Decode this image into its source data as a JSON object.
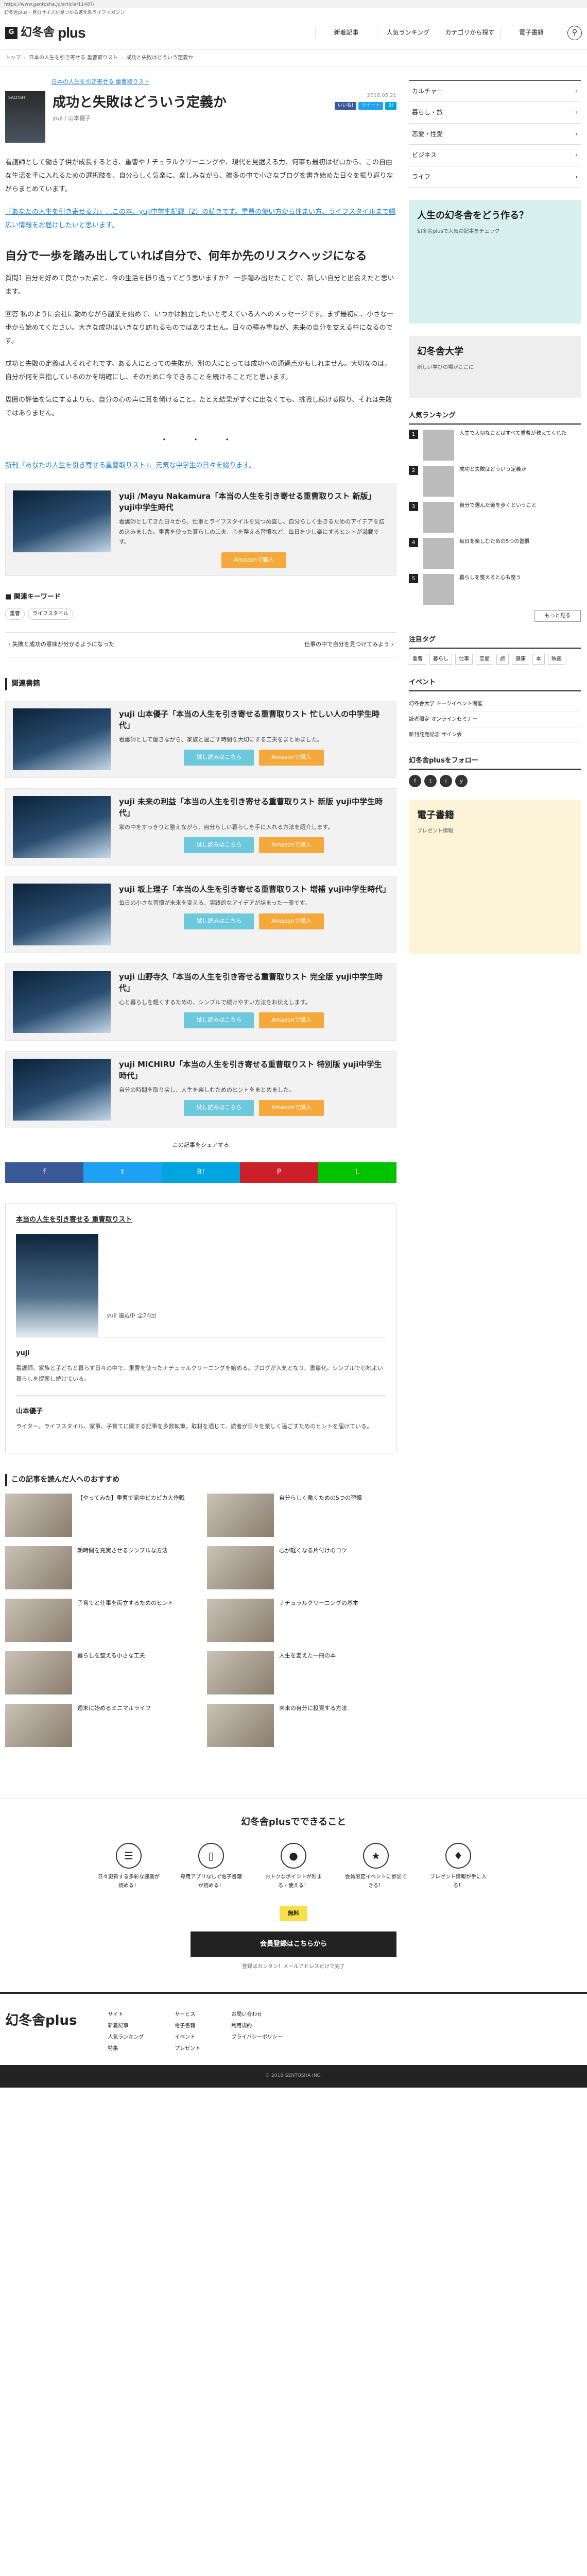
{
  "url": "https://www.gentosha.jp/article/11487/",
  "tagline": "幻冬舎plus - 自分サイズが見つかる進化系ライフマガジン",
  "brand": {
    "logo_mark": "G",
    "name_jp": "幻冬舎",
    "name_en": "plus"
  },
  "nav": {
    "items": [
      "新着記事",
      "人気ランキング",
      "カテゴリから探す",
      "電子書籍"
    ]
  },
  "breadcrumb": [
    "トップ",
    "日本の人生を引き寄せる 重曹取りスト",
    "成功と失敗はどういう定義か"
  ],
  "article": {
    "series": "日本の人生を引き寄せる 重曹取りスト",
    "thumb_text": "SALTISH",
    "title": "成功と失敗はどういう定義か",
    "author": "yuji / 山本優子",
    "date": "2018.05.21",
    "share_buttons": [
      "いいね!",
      "ツイート",
      "B!"
    ],
    "paragraphs": [
      "看護師として働き子供が成長するとき、重曹やナチュラルクリーニングや、現代を見据える力、何事も最初はゼロから、この自由な生活を手に入れるための選択肢を、自分らしく気楽に、楽しみながら、雑多の中で小さなブログを書き始めた日々を振り返りながらまとめています。",
      "『あなたの人生を引き寄せる力』…この本、yuji中学生記録（2）の続きです。重曹の使い方から住まい方、ライフスタイルまで幅広い情報をお届けしたいと思います。"
    ],
    "h2_1": "自分で一歩を踏み出していれば自分で、何年か先のリスクヘッジになる",
    "body_1": [
      "質問1 自分を好めて良かった点と、今の生活を振り返ってどう思いますか？ 一歩踏み出せたことで、新しい自分と出会えたと思います。",
      "回答 私のように会社に勤めながら副業を始めて、いつかは独立したいと考えている人へのメッセージです。まず最初に、小さな一歩から始めてください。大きな成功はいきなり訪れるものではありません。日々の積み重ねが、未来の自分を支える柱になるのです。",
      "成功と失敗の定義は人それぞれです。ある人にとっての失敗が、別の人にとっては成功への通過点かもしれません。大切なのは、自分が何を目指しているのかを明確にし、そのために今できることを続けることだと思います。",
      "周囲の評価を気にするよりも、自分の心の声に耳を傾けること。たとえ結果がすぐに出なくても、挑戦し続ける限り、それは失敗ではありません。"
    ],
    "dots": "・ ・ ・",
    "footnote": "新刊『あなたの人生を引き寄せる重曹取りスト』、元気な中学生の日々を綴ります。",
    "promo": {
      "title": "yuji /Mayu Nakamura「本当の人生を引き寄せる重曹取りスト 新版」yuji中学生時代",
      "desc": "看護師としてきた日々から、仕事とライフスタイルを見つめ直し、自分らしく生きるためのアイデアを詰め込みました。重曹を使った暮らしの工夫、心を整える習慣など、毎日を少し楽にするヒントが満載です。",
      "btn_buy": "Amazonで購入",
      "btn_preview": "試し読みはこちら"
    }
  },
  "keyword": {
    "label": "関連キーワード",
    "tags": [
      "重曹",
      "ライフスタイル"
    ]
  },
  "prevnext": {
    "prev": "失敗と成功の意味が分かるようになった",
    "next": "仕事の中で自分を見つけてみよう"
  },
  "related": {
    "title": "関連書籍",
    "items": [
      {
        "title": "yuji 山本優子「本当の人生を引き寄せる重曹取りスト 忙しい人の中学生時代」",
        "desc": "看護師として働きながら、家族と過ごす時間を大切にする工夫をまとめました。"
      },
      {
        "title": "yuji 未来の利益「本当の人生を引き寄せる重曹取りスト 新版 yuji中学生時代」",
        "desc": "家の中をすっきりと整えながら、自分らしい暮らしを手に入れる方法を紹介します。"
      },
      {
        "title": "yuji 坂上理子「本当の人生を引き寄せる重曹取りスト 増補 yuji中学生時代」",
        "desc": "毎日の小さな習慣が未来を変える、実践的なアイデアが詰まった一冊です。"
      },
      {
        "title": "yuji 山野寺久「本当の人生を引き寄せる重曹取りスト 完全版 yuji中学生時代」",
        "desc": "心と暮らしを軽くするための、シンプルで続けやすい方法をお伝えします。"
      },
      {
        "title": "yuji MICHIRU「本当の人生を引き寄せる重曹取りスト 特別版 yuji中学生時代」",
        "desc": "自分の時間を取り戻し、人生を楽しむためのヒントをまとめました。"
      }
    ]
  },
  "share": {
    "label": "この記事をシェアする",
    "buttons": [
      "f",
      "t",
      "B!",
      "P",
      "L"
    ]
  },
  "magazine": {
    "title": "本当の人生を引き寄せる 重曹取りスト",
    "info": "yuji 連載中 全24回",
    "profile_name": "yuji",
    "profile_text": "看護師。家族と子どもと暮らす日々の中で、重曹を使ったナチュラルクリーニングを始める。ブログが人気となり、書籍化。シンプルで心地よい暮らしを提案し続けている。",
    "author2_name": "山本優子",
    "author2_text": "ライター。ライフスタイル、家事、子育てに関する記事を多数執筆。取材を通じて、読者が日々を楽しく過ごすためのヒントを届けている。"
  },
  "recommend": {
    "title": "この記事を読んだ人へのおすすめ",
    "items": [
      "【やってみた】重曹で家中ピカピカ大作戦",
      "自分らしく働くための5つの習慣",
      "朝時間を充実させるシンプルな方法",
      "心が軽くなる片付けのコツ",
      "子育てと仕事を両立するためのヒント",
      "ナチュラルクリーニングの基本",
      "暮らしを整える小さな工夫",
      "人生を変えた一冊の本",
      "週末に始めるミニマルライフ",
      "未来の自分に投資する方法"
    ]
  },
  "sidebar": {
    "nav": [
      "カルチャー",
      "暮らし・旅",
      "恋愛・性愛",
      "ビジネス",
      "ライフ"
    ],
    "ad": {
      "title": "人生の幻冬舎をどう作る？",
      "sub": "幻冬舎plusで人気の記事をチェック"
    },
    "ad2": {
      "title": "幻冬舎大学",
      "sub": "新しい学びの場がここに"
    },
    "ranking_title": "人気ランキング",
    "ranking": [
      "人生で大切なことはすべて重曹が教えてくれた",
      "成功と失敗はどういう定義か",
      "自分で選んだ道を歩くということ",
      "毎日を楽しむための5つの習慣",
      "暮らしを整えると心も整う"
    ],
    "more": "もっと見る",
    "tag_title": "注目タグ",
    "tags": [
      "重曹",
      "暮らし",
      "仕事",
      "恋愛",
      "旅",
      "健康",
      "本",
      "映画"
    ],
    "event_title": "イベント",
    "events": [
      "幻冬舎大学 トークイベント開催",
      "読者限定 オンラインセミナー",
      "新刊発売記念 サイン会"
    ],
    "follow_title": "幻冬舎plusをフォロー",
    "sns": [
      "f",
      "t",
      "i",
      "y"
    ],
    "book_title": "電子書籍",
    "book_sub": "プレゼント情報"
  },
  "footer_promo": {
    "title": "幻冬舎plusでできること",
    "features": [
      "日々更新する多彩な連載が読める！",
      "専用アプリなしで電子書籍が読める！",
      "おトクなポイントが貯まる・使える！",
      "会員限定イベントに参加できる！",
      "プレゼント情報が手に入る！"
    ],
    "trial": "無料",
    "register": "会員登録はこちらから",
    "note": "登録はカンタン！メールアドレスだけで完了"
  },
  "footer": {
    "logo": "幻冬舎plus",
    "col1": [
      "サイト",
      "新着記事",
      "人気ランキング",
      "特集"
    ],
    "col2": [
      "サービス",
      "電子書籍",
      "イベント",
      "プレゼント"
    ],
    "col3": [
      "お問い合わせ",
      "利用規約",
      "プライバシーポリシー"
    ],
    "copyright": "© 2018 GENTOSHA INC."
  }
}
